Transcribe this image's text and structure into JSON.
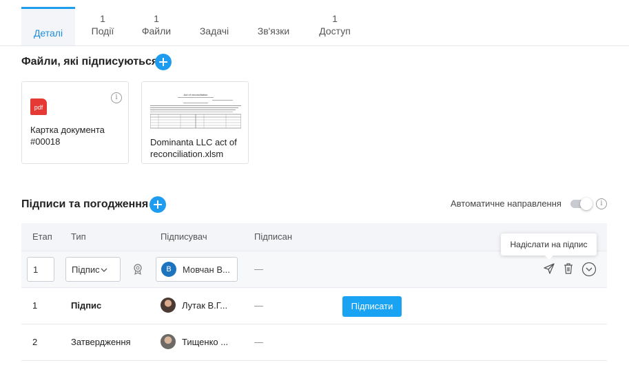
{
  "tabs": [
    {
      "label": "Деталі",
      "count": ""
    },
    {
      "label": "Події",
      "count": "1"
    },
    {
      "label": "Файли",
      "count": "1"
    },
    {
      "label": "Задачі",
      "count": ""
    },
    {
      "label": "Зв'язки",
      "count": ""
    },
    {
      "label": "Доступ",
      "count": "1"
    }
  ],
  "files_section": {
    "title": "Файли, які підписуються",
    "files": [
      {
        "type_icon": "pdf",
        "name_line1": "Картка документа",
        "name_line2": "#00018"
      },
      {
        "type_icon": "xlsx-preview",
        "name_line1": "Dominanta LLC act of",
        "name_line2": "reconciliation.xlsm",
        "preview_title": "Act of reconciliation"
      }
    ]
  },
  "signatures": {
    "title": "Підписи та погодження",
    "auto_routing_label": "Автоматичне направлення",
    "auto_routing_enabled": false,
    "columns": [
      "Етап",
      "Тип",
      "Підписувач",
      "Підписан"
    ],
    "edit_row": {
      "stage": "1",
      "type": "Підпис",
      "signer_initial": "В",
      "signer": "Мовчан В...",
      "signed": "—"
    },
    "rows": [
      {
        "stage": "1",
        "type": "Підпис",
        "signer": "Лутак В.Г...",
        "signed": "—",
        "action": "Підписати"
      },
      {
        "stage": "2",
        "type": "Затвердження",
        "signer": "Тищенко ...",
        "signed": "—"
      }
    ],
    "tooltip": "Надіслати на підпис"
  },
  "colors": {
    "accent": "#1e9cf0",
    "pdf": "#e53935"
  }
}
